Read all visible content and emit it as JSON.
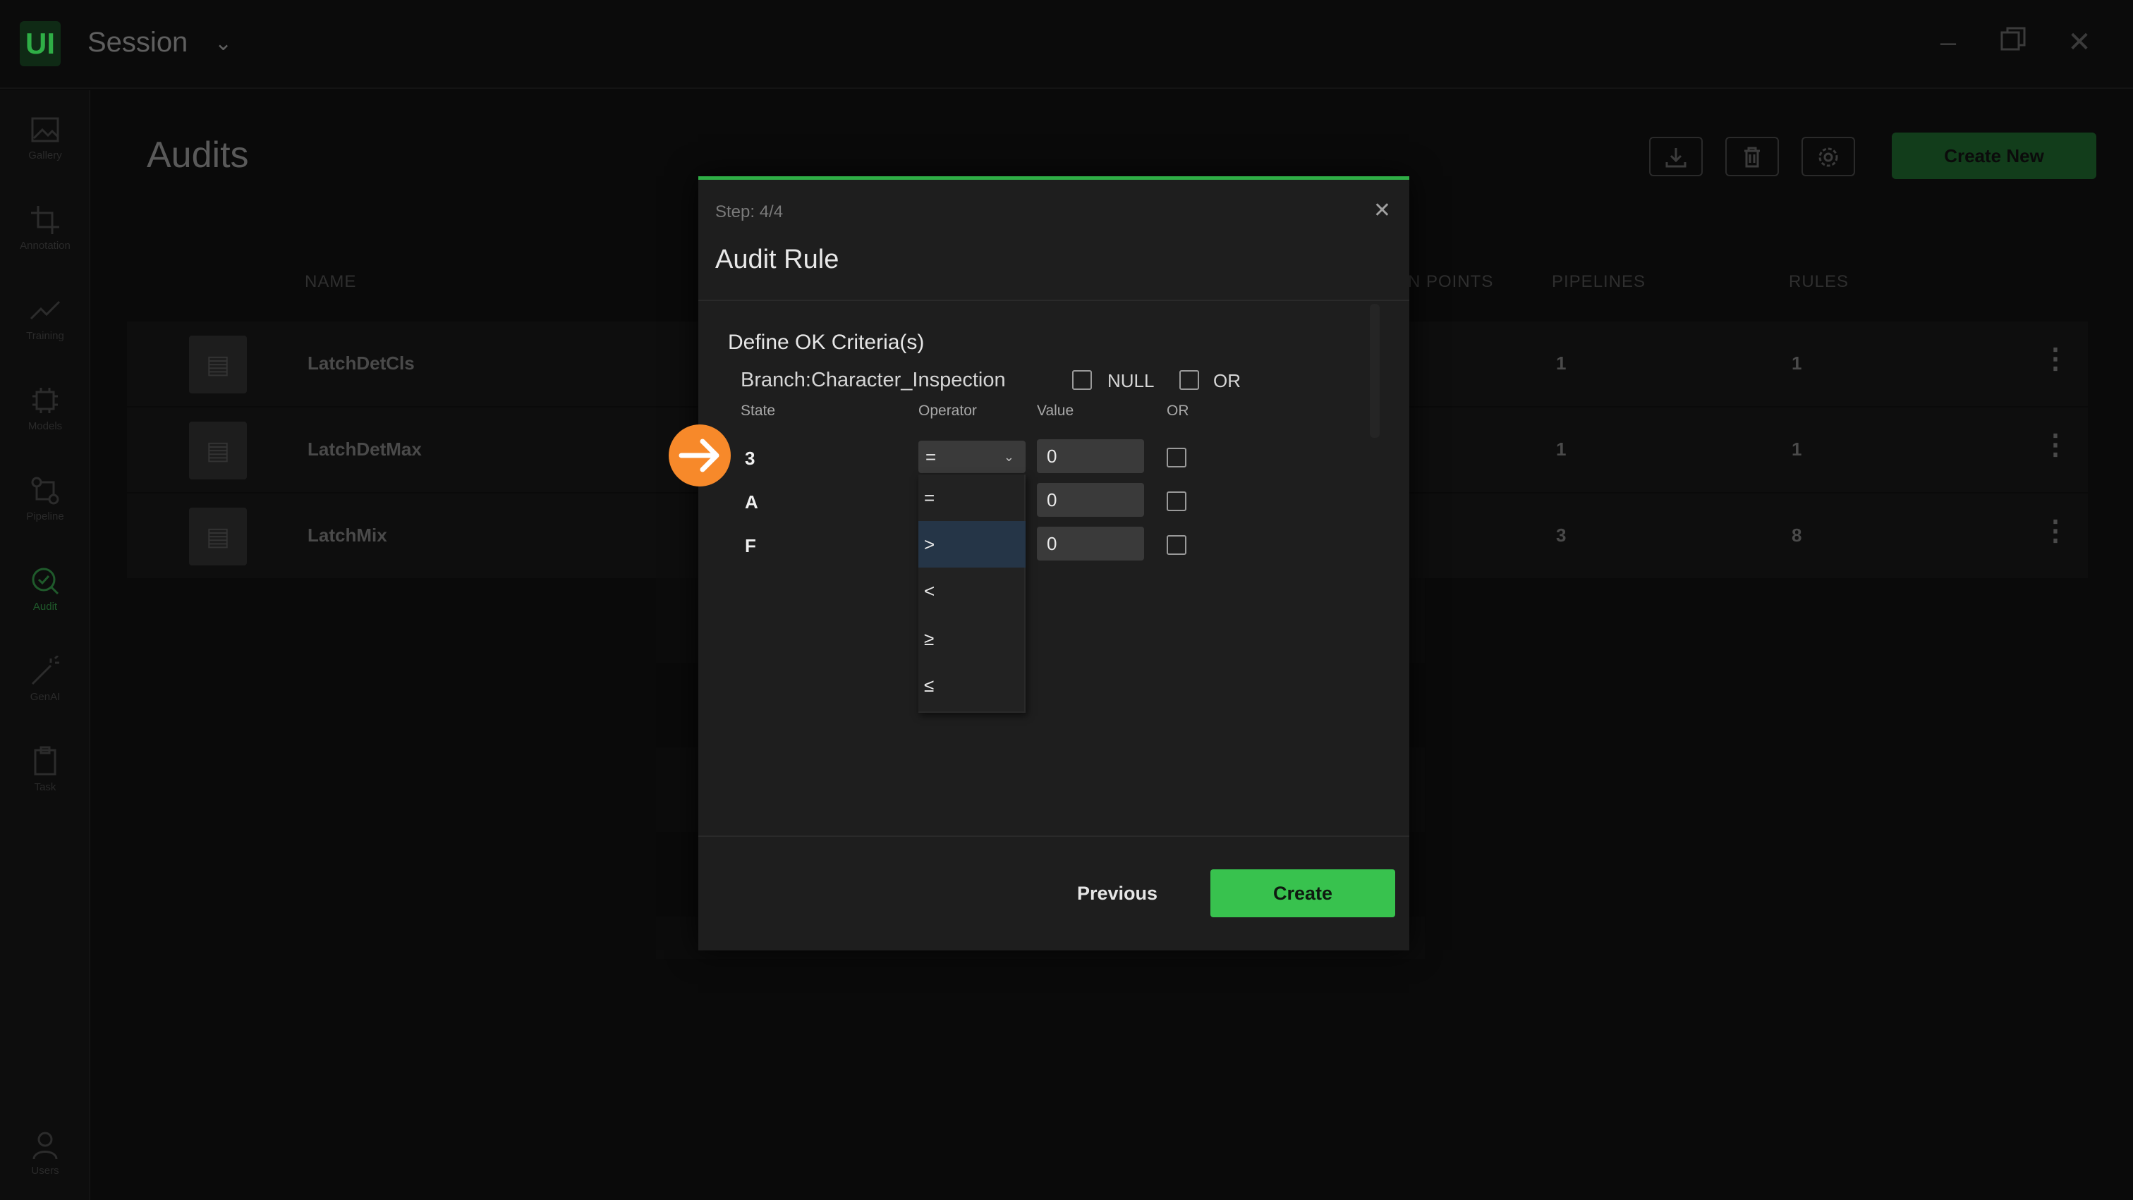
{
  "app": {
    "logo": "UI",
    "session_title": "Session",
    "window_controls": [
      "minimize-icon",
      "restore-icon",
      "close-icon"
    ]
  },
  "sidebar": {
    "items": [
      {
        "label": "Gallery",
        "icon": "image-icon"
      },
      {
        "label": "Annotation",
        "icon": "crop-icon"
      },
      {
        "label": "Training",
        "icon": "trend-icon"
      },
      {
        "label": "Models",
        "icon": "chip-icon"
      },
      {
        "label": "Pipeline",
        "icon": "pipeline-icon"
      },
      {
        "label": "Audit",
        "icon": "audit-icon",
        "active": true
      },
      {
        "label": "GenAI",
        "icon": "wand-icon"
      },
      {
        "label": "Task",
        "icon": "clipboard-icon"
      }
    ],
    "bottom_item": {
      "label": "Users",
      "icon": "user-icon"
    }
  },
  "page": {
    "title": "Audits",
    "create_new_label": "Create New",
    "columns": [
      "NAME",
      "N POINTS",
      "PIPELINES",
      "RULES"
    ],
    "rows": [
      {
        "name": "LatchDetCls",
        "pipelines": "1",
        "rules": "1"
      },
      {
        "name": "LatchDetMax",
        "pipelines": "1",
        "rules": "1"
      },
      {
        "name": "LatchMix",
        "pipelines": "3",
        "rules": "8"
      }
    ]
  },
  "modal": {
    "step": "Step: 4/4",
    "title": "Audit Rule",
    "criteria_title": "Define OK Criteria(s)",
    "branch": "Branch:Character_Inspection",
    "null_label": "NULL",
    "or_label": "OR",
    "headers": {
      "state": "State",
      "operator": "Operator",
      "value": "Value",
      "or": "OR"
    },
    "rules": [
      {
        "state": "3",
        "operator": "=",
        "value": "0"
      },
      {
        "state": "A",
        "operator": "=",
        "value": "0"
      },
      {
        "state": "F",
        "operator": ">",
        "value": "0"
      }
    ],
    "operator_options": [
      "=",
      ">",
      "<",
      "≥",
      "≤"
    ],
    "selected_option": ">",
    "previous_label": "Previous",
    "create_label": "Create"
  },
  "colors": {
    "accent": "#38c24e",
    "pointer": "#f7892a",
    "modal_bg": "#1e1e1e"
  }
}
